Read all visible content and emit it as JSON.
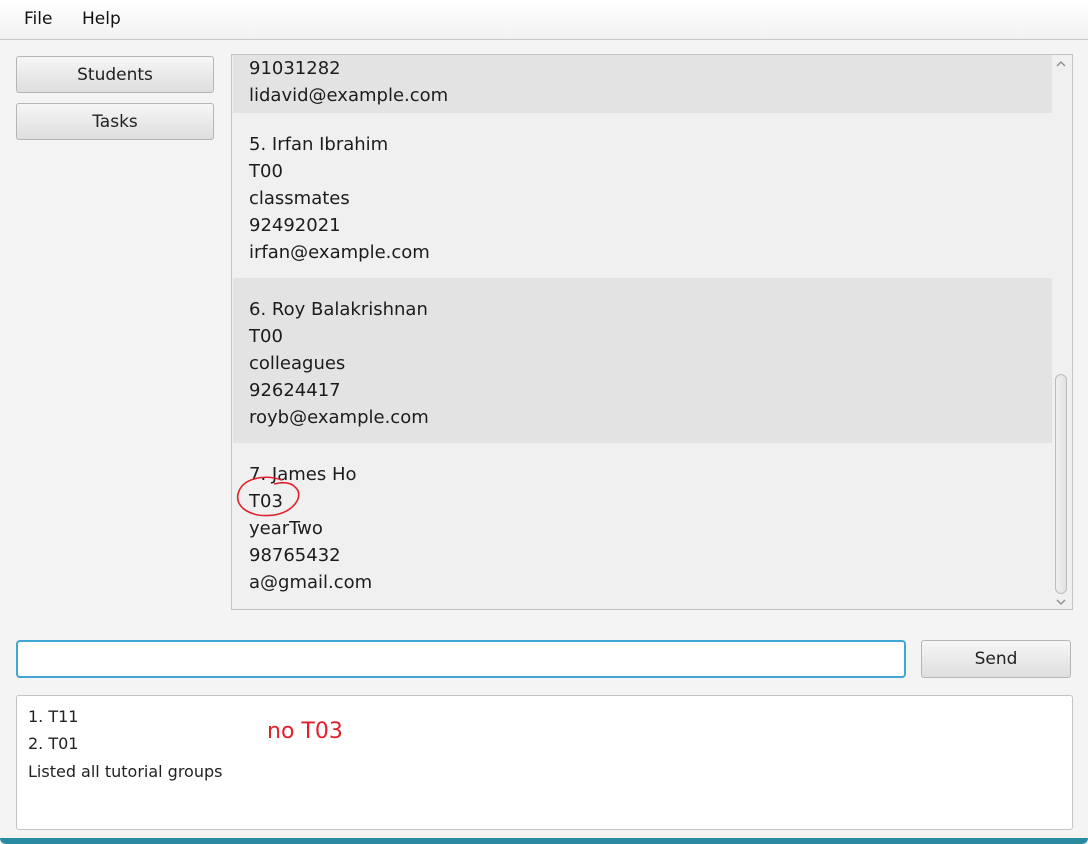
{
  "menu": {
    "file": "File",
    "help": "Help"
  },
  "sidebar": {
    "students": "Students",
    "tasks": "Tasks"
  },
  "persons": [
    {
      "phone": "91031282",
      "email": "lidavid@example.com"
    },
    {
      "name": "5.  Irfan Ibrahim",
      "group": "T00",
      "tag": "classmates",
      "phone": "92492021",
      "email": "irfan@example.com"
    },
    {
      "name": "6.  Roy Balakrishnan",
      "group": "T00",
      "tag": "colleagues",
      "phone": "92624417",
      "email": "royb@example.com"
    },
    {
      "name": "7.  James Ho",
      "group": "T03",
      "tag": "yearTwo",
      "phone": "98765432",
      "email": "a@gmail.com"
    }
  ],
  "command": {
    "value": "",
    "send_label": "Send"
  },
  "result": {
    "lines": [
      "1. T11",
      "2. T01",
      "Listed all tutorial groups"
    ]
  },
  "annotation": {
    "text": "no T03",
    "color": "#e0202a"
  },
  "colors": {
    "accent": "#3fa6d6",
    "card_dark": "#e3e3e3",
    "card_light": "#f0f0f0"
  }
}
